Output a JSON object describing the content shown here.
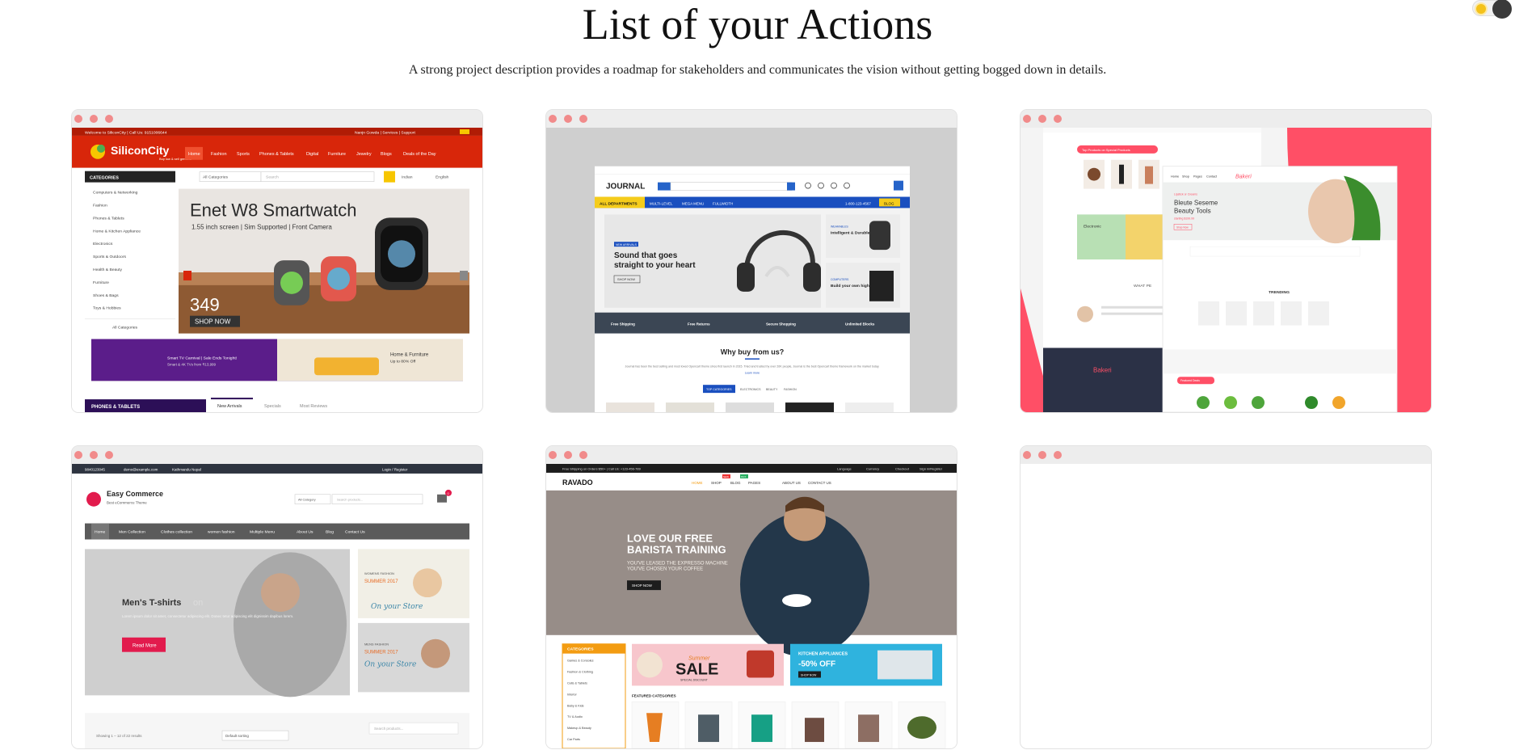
{
  "page": {
    "title": "List of your Actions",
    "subtitle": "A strong project description provides a roadmap for stakeholders and communicates the vision without getting bogged down in details."
  },
  "theme_toggle": {
    "sun_color": "#f4c21b",
    "knob_color": "#3a3a3a"
  },
  "cards": [
    {
      "id": "siliconcity",
      "topbar_left": "Welcome to SiliconCity  |  Call Us: 9151006644",
      "topbar_right": "Nanjn Gowda  |  Services  |  Support",
      "logo": "SiliconCity",
      "logo_tag": "Buy low & sell genuine",
      "nav": [
        "Home",
        "Fashion",
        "Sports",
        "Phones & Tablets",
        "Digital",
        "Furniture",
        "Jewelry",
        "Blogs",
        "Deals of the Day"
      ],
      "categories_title": "CATEGORIES",
      "categories": [
        "Computers & Networking",
        "Fashion",
        "Phones & Tablets",
        "Home & Kitchen Appliance",
        "Electronics",
        "Sports & Outdoors",
        "Health & Beauty",
        "Furniture",
        "Shoes & Bags",
        "Toys & Hobbies"
      ],
      "all_categories": "All Categories",
      "search_select": "All Categories",
      "search_placeholder": "Search",
      "lang1": "Indian",
      "lang2": "English",
      "hero_title": "Enet W8 Smartwatch",
      "hero_sub": "1.55 inch screen | Sim Supported | Front Camera",
      "hero_price": "349",
      "hero_button": "SHOP NOW",
      "promo_left_1": "Smart TV Carnival | Sale Ends Tonight!",
      "promo_left_2": "Smart & 4K TVs from ₹13,999",
      "promo_right_1": "Home & Furniture",
      "promo_right_2": "Up to 80% Off",
      "section_title": "PHONES & TABLETS",
      "tabs": [
        "New Arrivals",
        "Specials",
        "Most Reviews"
      ]
    },
    {
      "id": "journal",
      "logo": "JOURNAL",
      "menu": [
        "ALL DEPARTMENTS",
        "MULTI-LEVEL",
        "MEGA MENU",
        "FULLWIDTH"
      ],
      "phone": "1-800-123-4567",
      "blog": "BLOG",
      "hero_badge": "NEW ARRIVALS",
      "hero_title_1": "Sound that goes",
      "hero_title_2": "straight to your heart",
      "hero_button": "SHOP NOW",
      "side1_badge": "WEARABLES",
      "side1_title": "Intelligent & Durable Design",
      "side2_badge": "COMPUTERS",
      "side2_title": "Build your own high powered PC",
      "features": [
        "Free Shipping",
        "Free Returns",
        "Secure Shopping",
        "Unlimited Blocks"
      ],
      "why_title": "Why buy from us?",
      "why_text": "Journal has been the best selling and most loved Opencart theme since first launch in 2015. Tried and trusted by over 20K people, Journal is the best Opencart theme framework on the market today.",
      "why_link": "Learn more",
      "tabs": [
        "TOP CATEGORIES",
        "ELECTRONICS",
        "BEAUTY",
        "FASHION"
      ]
    },
    {
      "id": "beauty",
      "ribbon": "Top Products on Special Products",
      "banner_label": "Electronic",
      "nav": [
        "Home",
        "Shop",
        "Pages",
        "Contact"
      ],
      "logo": "Bakeri",
      "hero_small": "Lipstick or Creams",
      "hero_title_1": "Bleute Seseme",
      "hero_title_2": "Beauty Tools",
      "hero_price": "starting $199.99",
      "hero_button": "Shop Now",
      "what_label": "WHAT PE",
      "trending": "TRENDING",
      "deal_ribbon": "Featured Deals",
      "accent": "#ff4f66"
    },
    {
      "id": "easy-commerce",
      "topbar_phone": "9840123045",
      "topbar_email": "demo@example.com",
      "topbar_location": "Kathmandu Nepal",
      "topbar_login": "Login / Register",
      "logo": "Easy Commerce",
      "logo_sub": "Best eCommerce Theme",
      "search_select": "All Category",
      "search_placeholder": "Search products...",
      "cart_count": "0",
      "nav": [
        "Home",
        "Men Collection",
        "Clothes collection",
        "women fashion",
        "Multiple Menu",
        "About Us",
        "Blog",
        "Contact Us"
      ],
      "hero_title": "Men's T-shirts",
      "hero_title_ghost": "on",
      "hero_text": "Lorem ipsum dolor sit amet, consectetur adipiscing elit. Donec tetur adipiscing elit dignissim dapibus lorem.",
      "hero_button": "Read More",
      "side1_label": "WOMENS FASHION",
      "side1_season": "SUMMER 2017",
      "side1_script": "On your Store",
      "side2_label": "MENS FASHION",
      "side2_season": "SUMMER 2017",
      "side2_script": "On your Store",
      "results": "Showing 1 – 12 of 22 results",
      "sort": "Default sorting",
      "sidebar_search": "Search products..."
    },
    {
      "id": "ravado",
      "topbar_left": "Free Shipping on Orders $50+  |  Call Us: +123-456-789",
      "topbar_right": [
        "Language",
        "Currency",
        "Checkout",
        "Sign in/Register"
      ],
      "logo": "RAVADO",
      "nav": [
        "HOME",
        "SHOP",
        "BLOG",
        "PAGES",
        "ABOUT US",
        "CONTACT US"
      ],
      "nav_badges": [
        "NEW",
        "HOT"
      ],
      "hero_title_1": "LOVE OUR FREE",
      "hero_title_2": "BARISTA TRAINING",
      "hero_sub_1": "YOU'VE LEASED THE EXPRESSO MACHINE",
      "hero_sub_2": "YOU'VE CHOSEN YOUR COFFEE",
      "hero_button": "SHOP NOW",
      "categories_title": "CATEGORIES",
      "categories": [
        "Games & Consoles",
        "Fashion & Clothing",
        "Cells & Tablets",
        "Interior",
        "Baby & Kids",
        "TV & Audio",
        "Makeup & Beauty",
        "Car Parts"
      ],
      "sale_small": "Summer",
      "sale_big": "SALE",
      "sale_sub": "SPECIAL DISCOUNT",
      "kitchen_title": "KITCHEN APPLIANCES",
      "kitchen_offer": "-50% OFF",
      "kitchen_button": "SHOP NOW",
      "featured": "FEATURED CATEGORIES"
    },
    {
      "id": "empty"
    }
  ]
}
